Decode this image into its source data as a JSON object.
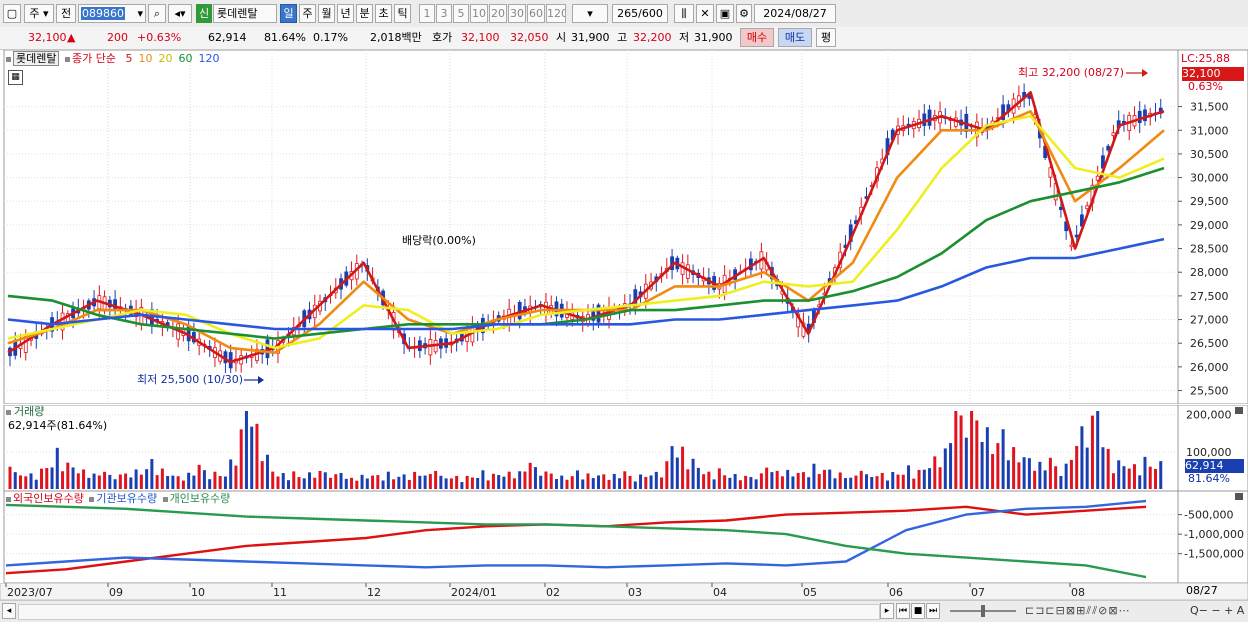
{
  "toolbar": {
    "mode": "주",
    "prev_label": "전",
    "code": "089860",
    "badge": "신",
    "name": "롯데렌탈",
    "periods": [
      "일",
      "주",
      "월",
      "년",
      "분",
      "초",
      "틱"
    ],
    "active_period": "일",
    "intervals": [
      "1",
      "3",
      "5",
      "10",
      "20",
      "30",
      "60",
      "120"
    ],
    "count": "265",
    "count_total": "/600",
    "date": "2024/08/27"
  },
  "quote": {
    "price": "32,100",
    "change": "200",
    "change_pct": "+0.63%",
    "volume": "62,914",
    "volume_pct": "81.64%",
    "turnover": "0.17%",
    "amount": "2,018백만",
    "ask_label": "호가",
    "ask1": "32,100",
    "ask2": "32,050",
    "open_label": "시",
    "open": "31,900",
    "high_label": "고",
    "high": "32,200",
    "low_label": "저",
    "low": "31,900",
    "buy_label": "매수",
    "sell_label": "매도",
    "avg_label": "평"
  },
  "price_panel": {
    "legend_name": "롯데렌탈",
    "legend_ma_prefix": "종가 단순",
    "ma_labels": [
      "5",
      "10",
      "20",
      "60",
      "120"
    ],
    "ma_colors": [
      "#d01818",
      "#f08a10",
      "#eeee20",
      "#1a9030",
      "#2858e0"
    ],
    "lc_label": "LC:25,88",
    "cur_price_tag": "32,100",
    "cur_pct_tag": "0.63%",
    "annot_high": "최고 32,200 (08/27)",
    "annot_low": "최저 25,500 (10/30)",
    "annot_ex": "배당락(0.00%)"
  },
  "volume_panel": {
    "title": "거래량",
    "subtitle": "62,914주(81.64%)",
    "tag_value": "62,914",
    "tag_pct": "81.64%"
  },
  "holding_panel": {
    "legend": [
      "외국인보유수량",
      "기관보유수량",
      "개인보유수량"
    ]
  },
  "x_axis": {
    "labels": [
      "2023/07",
      "09",
      "10",
      "11",
      "12",
      "2024/01",
      "02",
      "03",
      "04",
      "05",
      "06",
      "07",
      "08"
    ],
    "right_label": "08/27"
  },
  "chart_data": [
    {
      "type": "line",
      "title": "",
      "series": [
        {
          "name": "5",
          "color": "#d01818",
          "values": [
            26300,
            26900,
            27400,
            27100,
            26700,
            26100,
            26400,
            27300,
            28200,
            26400,
            26500,
            27000,
            27300,
            27000,
            27300,
            28200,
            27700,
            28300,
            26700,
            28800,
            31000,
            31300,
            31000,
            31800,
            28500,
            31100,
            31400
          ]
        },
        {
          "name": "10",
          "color": "#f08a10",
          "values": [
            26500,
            26800,
            27200,
            27200,
            26900,
            26400,
            26300,
            26900,
            27800,
            27000,
            26700,
            27000,
            27200,
            27200,
            27200,
            27700,
            27700,
            28000,
            27400,
            28200,
            30000,
            31000,
            31000,
            31400,
            29500,
            30200,
            31000
          ]
        },
        {
          "name": "20",
          "color": "#eeee20",
          "values": [
            26600,
            26800,
            27000,
            27200,
            27100,
            26700,
            26400,
            26600,
            27300,
            27200,
            26700,
            26800,
            27100,
            27200,
            27300,
            27400,
            27500,
            27800,
            27700,
            27800,
            28900,
            30200,
            31100,
            31300,
            30200,
            30000,
            30400
          ]
        },
        {
          "name": "60",
          "color": "#1a9030",
          "values": [
            27500,
            27400,
            27100,
            26900,
            26800,
            26700,
            26600,
            26700,
            26800,
            26900,
            26900,
            26900,
            26900,
            27000,
            27200,
            27200,
            27300,
            27400,
            27400,
            27600,
            27900,
            28400,
            29100,
            29500,
            29700,
            29900,
            30200
          ]
        },
        {
          "name": "120",
          "color": "#2858e0",
          "values": [
            27000,
            26900,
            27000,
            27100,
            27000,
            26900,
            26800,
            26800,
            26800,
            26800,
            26800,
            26900,
            26900,
            26900,
            26900,
            27000,
            27000,
            27100,
            27200,
            27300,
            27400,
            27700,
            28100,
            28300,
            28300,
            28500,
            28700
          ]
        }
      ],
      "ylim": [
        25300,
        32400
      ],
      "ticks": [
        "31,500",
        "31,000",
        "30,500",
        "30,000",
        "29,500",
        "29,000",
        "28,500",
        "28,000",
        "27,500",
        "27,000",
        "26,500",
        "26,000",
        "25,500"
      ]
    },
    {
      "type": "bar",
      "title": "거래량",
      "values": [
        40000,
        35000,
        75000,
        45000,
        30000,
        40000,
        55000,
        30000,
        45000,
        35000,
        195000,
        40000,
        30000,
        45000,
        25000,
        35000,
        30000,
        40000,
        30000,
        30000,
        35000,
        40000,
        50000,
        30000,
        35000,
        35000,
        30000,
        40000,
        100000,
        40000,
        35000,
        30000,
        45000,
        40000,
        50000,
        30000,
        35000,
        40000,
        45000,
        95000,
        200000,
        120000,
        90000,
        60000,
        50000,
        185000,
        70000,
        55000,
        62914
      ],
      "ylim": [
        0,
        210000
      ],
      "ticks": [
        "200,000",
        "100,000"
      ]
    },
    {
      "type": "line",
      "title": "보유수량",
      "series": [
        {
          "name": "외국인보유수량",
          "color": "#dd1111",
          "values": [
            -2000000,
            -1900000,
            -1700000,
            -1500000,
            -1300000,
            -1200000,
            -1100000,
            -900000,
            -800000,
            -750000,
            -800000,
            -700000,
            -650000,
            -500000,
            -450000,
            -400000,
            -300000,
            -500000,
            -400000,
            -300000
          ]
        },
        {
          "name": "기관보유수량",
          "color": "#3366dd",
          "values": [
            -1800000,
            -1700000,
            -1600000,
            -1650000,
            -1700000,
            -1750000,
            -1800000,
            -1850000,
            -1800000,
            -1800000,
            -1850000,
            -1800000,
            -1750000,
            -1800000,
            -1700000,
            -900000,
            -500000,
            -350000,
            -300000,
            -150000
          ]
        },
        {
          "name": "개인보유수량",
          "color": "#2a9a50",
          "values": [
            -250000,
            -300000,
            -350000,
            -450000,
            -550000,
            -600000,
            -650000,
            -700000,
            -750000,
            -750000,
            -800000,
            -850000,
            -900000,
            -1000000,
            -1300000,
            -1500000,
            -1600000,
            -1700000,
            -1800000,
            -2100000
          ]
        }
      ],
      "ylim": [
        -2200000,
        -100000
      ],
      "ticks": [
        "-500,000",
        "-1,000,000",
        "-1,500,000"
      ]
    }
  ]
}
